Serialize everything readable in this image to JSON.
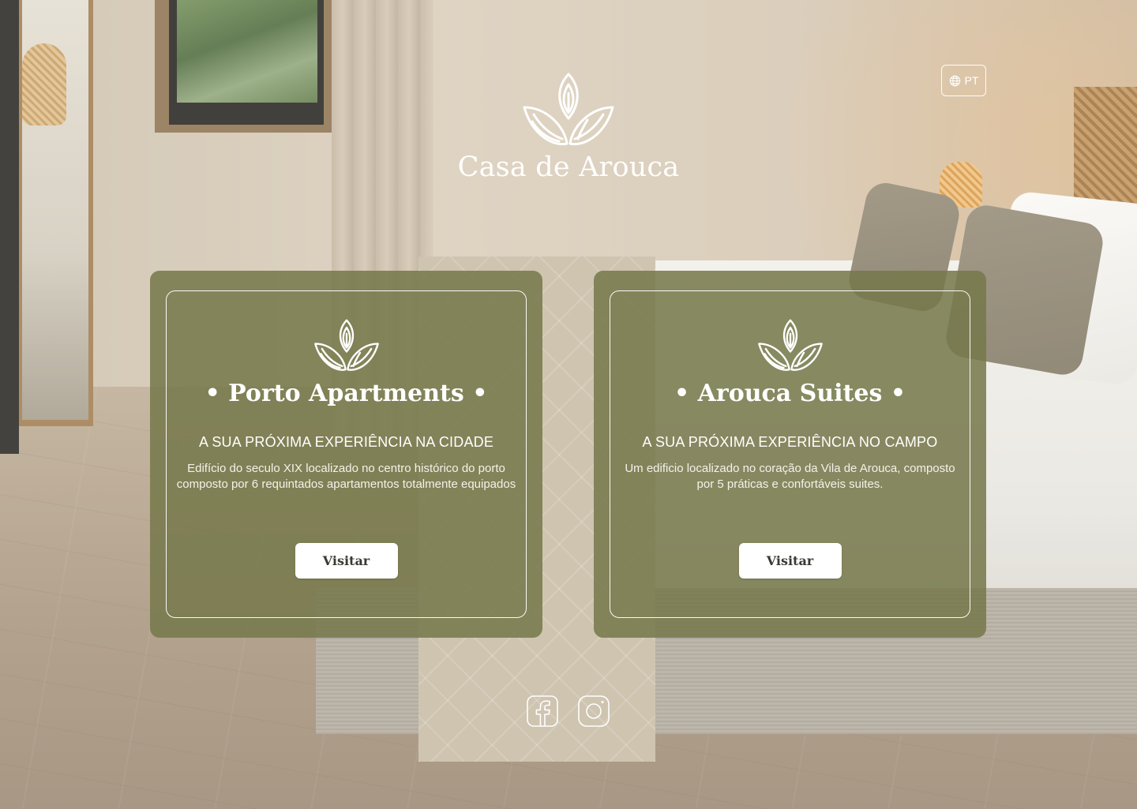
{
  "brand": {
    "name": "Casa de Arouca",
    "logo_icon": "lotus-leaves-icon"
  },
  "language": {
    "label": "PT",
    "icon": "globe-icon"
  },
  "cards": [
    {
      "title": "• Porto Apartments •",
      "subtitle": "A SUA PRÓXIMA EXPERIÊNCIA NA CIDADE",
      "description": "Edifício do seculo XIX localizado no centro histórico do porto composto por 6 requintados apartamentos totalmente equipados",
      "button_label": "Visitar",
      "icon": "lotus-leaves-icon"
    },
    {
      "title": "• Arouca Suites •",
      "subtitle": "A SUA PRÓXIMA EXPERIÊNCIA NO CAMPO",
      "description": "Um edificio localizado no coração da Vila de Arouca, composto por 5 práticas e confortáveis suites.",
      "button_label": "Visitar",
      "icon": "lotus-leaves-icon"
    }
  ],
  "social": {
    "icons": [
      "facebook-icon",
      "instagram-icon"
    ]
  },
  "colors": {
    "card_bg": "#76784A",
    "text": "#FFFFFF",
    "button_bg": "#FFFFFF",
    "button_text": "#3A3A32"
  }
}
